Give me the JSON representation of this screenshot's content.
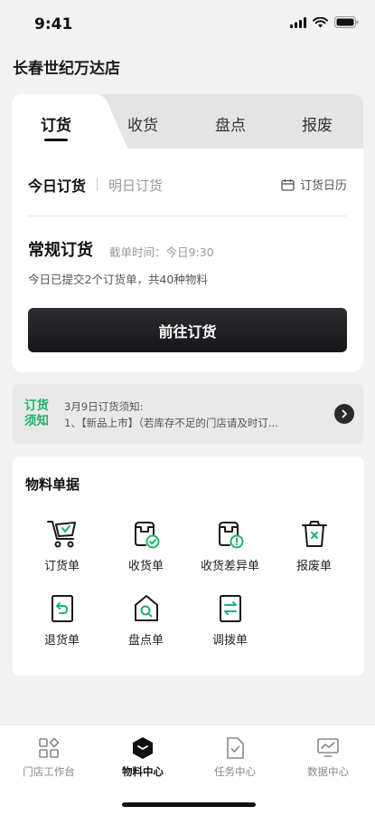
{
  "status": {
    "time": "9:41"
  },
  "store": {
    "name": "长春世纪万达店"
  },
  "tabs": [
    {
      "label": "订货",
      "active": true
    },
    {
      "label": "收货",
      "active": false
    },
    {
      "label": "盘点",
      "active": false
    },
    {
      "label": "报废",
      "active": false
    }
  ],
  "order": {
    "today_label": "今日订货",
    "tomorrow_label": "明日订货",
    "calendar_label": "订货日历",
    "type_title": "常规订货",
    "cutoff_text": "截单时间：今日9:30",
    "summary_text": "今日已提交2个订货单，共40种物料",
    "go_button": "前往订货"
  },
  "notice": {
    "tag": "订货须知",
    "title": "3月9日订货须知:",
    "body": "1、【新品上市】（若库存不足的门店请及时订..."
  },
  "materials": {
    "title": "物料单据",
    "items": [
      {
        "label": "订货单",
        "icon": "cart-icon"
      },
      {
        "label": "收货单",
        "icon": "receive-icon"
      },
      {
        "label": "收货差异单",
        "icon": "receive-diff-icon"
      },
      {
        "label": "报废单",
        "icon": "trash-icon"
      },
      {
        "label": "退货单",
        "icon": "return-icon"
      },
      {
        "label": "盘点单",
        "icon": "inventory-icon"
      },
      {
        "label": "调拨单",
        "icon": "transfer-icon"
      }
    ]
  },
  "nav": [
    {
      "label": "门店工作台",
      "active": false
    },
    {
      "label": "物料中心",
      "active": true
    },
    {
      "label": "任务中心",
      "active": false
    },
    {
      "label": "数据中心",
      "active": false
    }
  ],
  "colors": {
    "accent": "#1db36b",
    "dark": "#16161a"
  }
}
